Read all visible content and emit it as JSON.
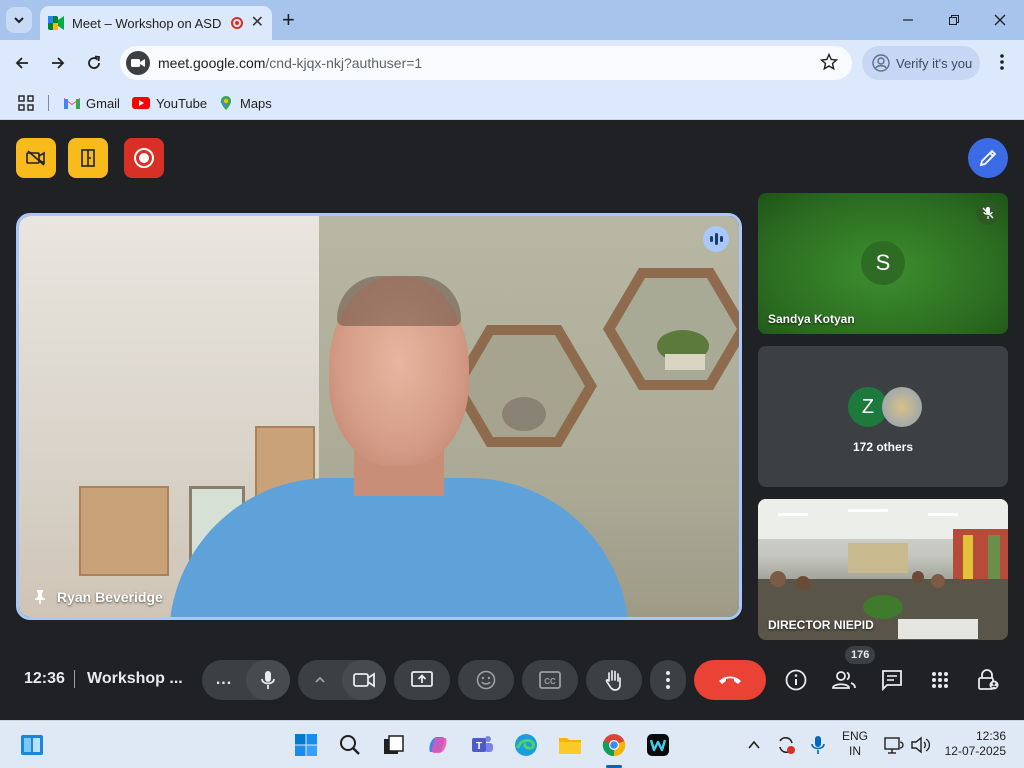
{
  "browser": {
    "tab_title": "Meet – Workshop on ASD",
    "url_host": "meet.google.com",
    "url_path": "/cnd-kjqx-nkj?authuser=1",
    "verify_label": "Verify it's you",
    "bookmarks": [
      {
        "label": "Gmail",
        "icon": "gmail-icon"
      },
      {
        "label": "YouTube",
        "icon": "youtube-icon"
      },
      {
        "label": "Maps",
        "icon": "maps-icon"
      }
    ]
  },
  "meet": {
    "host_controls": [
      "camera-off-icon",
      "door-icon",
      "record-icon"
    ],
    "colors": {
      "host_yellow": "#f9ba1c",
      "record_red": "#d93025",
      "accent_blue": "#3b6ce6",
      "end_call": "#ea4335"
    },
    "main_tile": {
      "name": "Ryan Beveridge",
      "speaking": true,
      "pinned": true
    },
    "side_tiles": [
      {
        "name": "Sandya Kotyan",
        "avatar_letter": "S",
        "muted": true
      },
      {
        "avatar_letter": "Z",
        "others_label": "172 others"
      },
      {
        "name": "DIRECTOR NIEPID"
      }
    ],
    "time": "12:36",
    "meeting_title": "Workshop ...",
    "more_label": "...",
    "people_count": "176"
  },
  "taskbar": {
    "lang_line1": "ENG",
    "lang_line2": "IN",
    "time": "12:36",
    "date": "12-07-2025"
  }
}
